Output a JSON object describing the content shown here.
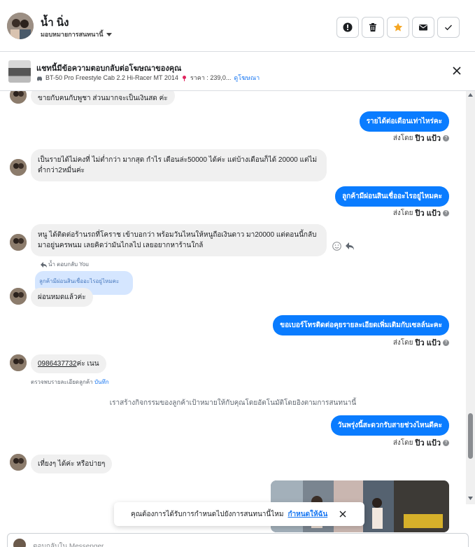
{
  "header": {
    "contact_name": "น้ำ นิ่ง",
    "assign_label": "มอบหมายการสนทนานี้",
    "buttons": [
      "flag-icon",
      "trash-icon",
      "star-icon",
      "envelope-icon",
      "check-icon"
    ],
    "accent_star": "#f5a623"
  },
  "banner": {
    "title": "แชทนี้มีข้อความตอบกลับต่อโฆษณาของคุณ",
    "item": "BT-50 Pro Freestyle Cab 2.2 Hi-Racer MT 2014",
    "price": "ราคา : 239,0...",
    "link": "ดูโฆษณา"
  },
  "messages": {
    "m0": "ขายกับคนกับพูชา  ส่วนมากจะเป็นเงินสด ค่ะ",
    "m1": "รายได้ต่อเดือนเท่าไหร่คะ",
    "m2": "เป็นรายได้ไม่คงที่ ไม่ต่ำกว่า มากสุด กำไร เดือนล่ะ50000 ได้ค่ะ แต่บ้างเดือนก็ได้ 20000 แต่ไม่ต่ำกว่า2หมื่นค่ะ",
    "m3": "ลูกค้ามีผ่อนสินเชื่ออะไรอยู่ไหมคะ",
    "m4": "หนู ได้ติดต่อร้านรถที่โคราช  เข้าบอกว่า พร้อมวันไหนให้หนูถือเงินดาว มา20000 แต่ตอนนี้กลับมาอยู่นครพนม  เลยคิดว่ามันไกลไป เลยอยากหาร้านใกล้",
    "reply_meta": "น้ำ ตอบกลับ You",
    "quoted": "ลูกค้ามีผ่อนสินเชื่ออะไรอยู่ไหมคะ",
    "m5": "ผ่อนหมดแล้วค่ะ",
    "m6": "ขอเบอร์โทรติดต่อคุยรายละเอียดเพิ่มเติมกับเซลล์นะคะ",
    "m7_phone": "0986437732",
    "m7_rest": "ค่ะ เนน",
    "m7_note": "ตรวจพบรายละเอียดลูกค้า",
    "m7_note_link": "บันทึก",
    "system": "เราสร้างกิจกรรมของลูกค้าเป้าหมายให้กับคุณโดยอัตโนมัติโดยอิงตามการสนทนานี้",
    "m8": "วันพรุ่งนี้สะดวกรับสายช่วงไหนดีคะ",
    "m9": "เที่ยงๆ ได้ค่ะ หรือบ่ายๆ"
  },
  "sent_by": {
    "prefix": "ส่งโดย",
    "name": "ปิว แป้ว",
    "help": "?"
  },
  "toast": {
    "text": "คุณต้องการได้รับการกำหนดไปยังการสนทนานี้ไหม",
    "link": "กำหนดให้ฉัน"
  },
  "composer": {
    "placeholder": "ตอบกลับใน Messenger..."
  },
  "colors": {
    "outgoing": "#0a7cff",
    "incoming": "#f0f0f0",
    "link": "#1877f2"
  }
}
